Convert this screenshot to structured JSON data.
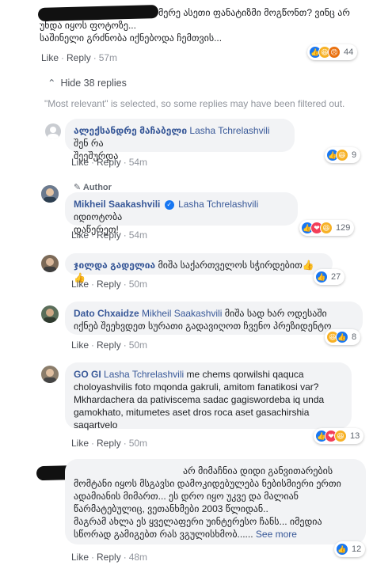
{
  "comments": [
    {
      "id": "c1",
      "author": "",
      "text_line1": "მერე ასეთი ფანატიზმი მოგწონთ? ვინც არ",
      "text_line2": "უნდა იყოს ფოტოზე...",
      "text_line3": "საშინელი გრძნობა იქნებოდა ჩემთვის...",
      "like": "Like",
      "reply": "Reply",
      "time": "57m",
      "reaction_count": "44",
      "reactions": [
        "like-icon",
        "haha-icon",
        "angry-icon"
      ]
    }
  ],
  "hide_replies": "Hide 38 replies",
  "most_relevant_note": "\"Most relevant\" is selected, so some replies may have been filtered out.",
  "replies": [
    {
      "author": "ალექსანდრე მაჩაბელი",
      "mention": "Lasha Tchrelashvili",
      "text": " შენ რა",
      "text2": "შეეშურდა",
      "like": "Like",
      "reply": "Reply",
      "time": "54m",
      "reaction_count": "9"
    },
    {
      "tag": "Author",
      "author": "Mikheil Saakashvili",
      "mention": "Lasha Tchrelashvili",
      "text": " იდიოტობა",
      "text2": "დაწერეთ!",
      "like": "Like",
      "reply": "Reply",
      "time": "54m",
      "reaction_count": "129"
    },
    {
      "author": "ჯილდა გადელია",
      "text": " მიშა საქართველოს სჭირდებით👍👍",
      "like": "Like",
      "reply": "Reply",
      "time": "50m",
      "reaction_count": "27"
    },
    {
      "author": "Dato Chxaidze",
      "mention": "Mikheil Saakashvili",
      "text": " მიშა სად ხარ ოდესაში",
      "text2": "იქნებ შეეხვდეთ სურათი გადავიღოთ ჩვენო პრეზიდენტო",
      "like": "Like",
      "reply": "Reply",
      "time": "50m",
      "reaction_count": "8"
    },
    {
      "author": "GO GI",
      "mention": "Lasha Tchrelashvili",
      "text": " me chems qorwilshi qaquca",
      "text2": "choloyashvilis foto mqonda gakruli, amitom fanatikosi var?",
      "text3": "Mkhardachera da pativiscema sadac gagiswordeba iq unda",
      "text4": "gamokhato, mitumetes aset dros roca aset gasachirshia",
      "text5": "saqartvelo",
      "like": "Like",
      "reply": "Reply",
      "time": "50m",
      "reaction_count": "13"
    },
    {
      "author": "",
      "text": "არ მიმაჩნია დიდი განვითარების",
      "text2": "მომტანი იყოს მსგავსი დამოკიდებულება ნებისმიერი ერთი",
      "text3": "ადამიანის მიმართ... ეს დრო იყო უკვე და მალიან",
      "text4": "წარმატებულიც, ვეთანხმები 2003 წლიდან..",
      "text5": "მაგრამ ახლა ეს ყველაფერი უინტერესო ჩანს... იმედია",
      "text6": "სწორად გამიგებთ რას ვგულისხმობ......",
      "see_more": " See more",
      "like": "Like",
      "reply": "Reply",
      "time": "48m",
      "reaction_count": "12"
    }
  ],
  "colors": {
    "link_blue": "#385898",
    "bubble_bg": "#f2f3f5",
    "meta_gray": "#90949c",
    "like_blue": "#1877f2"
  }
}
